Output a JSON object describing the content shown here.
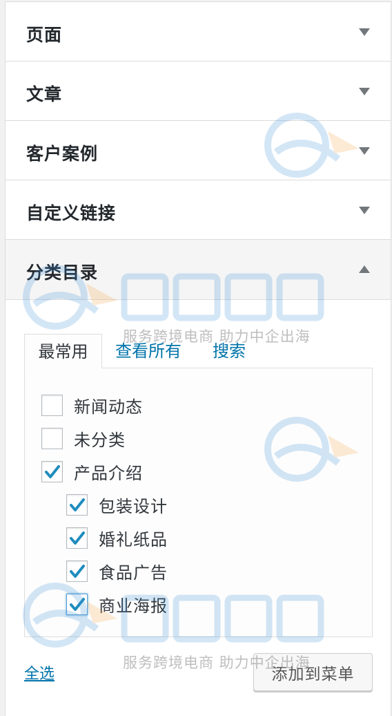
{
  "accordion": {
    "sections": [
      {
        "label": "页面",
        "expanded": false
      },
      {
        "label": "文章",
        "expanded": false
      },
      {
        "label": "客户案例",
        "expanded": false
      },
      {
        "label": "自定义链接",
        "expanded": false
      },
      {
        "label": "分类目录",
        "expanded": true
      }
    ]
  },
  "categories_panel": {
    "tabs": [
      {
        "label": "最常用",
        "active": true
      },
      {
        "label": "查看所有",
        "active": false
      },
      {
        "label": "搜索",
        "active": false
      }
    ],
    "items": [
      {
        "label": "新闻动态",
        "checked": false,
        "level": 0
      },
      {
        "label": "未分类",
        "checked": false,
        "level": 0
      },
      {
        "label": "产品介绍",
        "checked": true,
        "level": 0
      },
      {
        "label": "包装设计",
        "checked": true,
        "level": 1
      },
      {
        "label": "婚礼纸品",
        "checked": true,
        "level": 1
      },
      {
        "label": "食品广告",
        "checked": true,
        "level": 1
      },
      {
        "label": "商业海报",
        "checked": true,
        "level": 1
      }
    ],
    "select_all_label": "全选",
    "add_button_label": "添加到菜单"
  },
  "watermark": {
    "caption": "服务跨境电商 助力中企出海"
  },
  "colors": {
    "accent": "#0073aa",
    "check": "#1e8cbe",
    "watermark_blue": "#3a8fd8",
    "watermark_orange": "#f5a445"
  }
}
